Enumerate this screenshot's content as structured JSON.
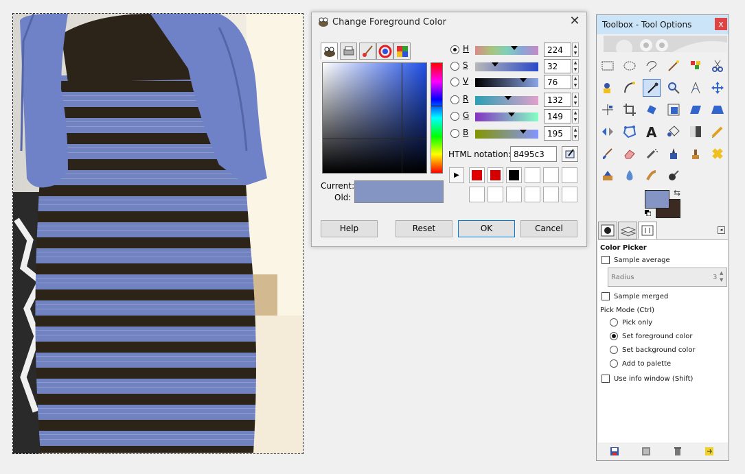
{
  "dialog": {
    "title": "Change Foreground Color",
    "close_glyph": "✕",
    "current_label": "Current:",
    "old_label": "Old:",
    "current_color": "#8495c3",
    "channels": [
      {
        "key": "H",
        "value": "224",
        "selected": true,
        "fraction": 0.62
      },
      {
        "key": "S",
        "value": "32",
        "selected": false,
        "fraction": 0.32
      },
      {
        "key": "V",
        "value": "76",
        "selected": false,
        "fraction": 0.76
      },
      {
        "key": "R",
        "value": "132",
        "selected": false,
        "fraction": 0.52
      },
      {
        "key": "G",
        "value": "149",
        "selected": false,
        "fraction": 0.58
      },
      {
        "key": "B",
        "value": "195",
        "selected": false,
        "fraction": 0.76
      }
    ],
    "html_notation_label": "HTML notation:",
    "html_notation_value": "8495c3",
    "history_colors": [
      "#e00000",
      "#d40000",
      "#000000",
      "#ffffff",
      "#ffffff",
      "#ffffff",
      "#ffffff",
      "#ffffff",
      "#ffffff",
      "#ffffff",
      "#ffffff",
      "#ffffff"
    ],
    "buttons": {
      "help": "Help",
      "reset": "Reset",
      "ok": "OK",
      "cancel": "Cancel"
    },
    "notebook_tabs": [
      "wilber-icon",
      "printer-icon",
      "paintbrush-icon",
      "color-wheel-icon",
      "palette-icon"
    ]
  },
  "toolbox": {
    "title": "Toolbox - Tool Options",
    "close_glyph": "x",
    "foreground_color": "#8495c3",
    "background_color": "#3b2a22",
    "tools": [
      "rect-select-icon",
      "ellipse-select-icon",
      "lasso-icon",
      "fuzzy-select-icon",
      "color-select-icon",
      "scissors-icon",
      "foreground-select-icon",
      "paths-icon",
      "color-picker-icon",
      "zoom-icon",
      "measure-icon",
      "move-icon",
      "align-icon",
      "crop-icon",
      "rotate-icon",
      "scale-icon",
      "shear-icon",
      "perspective-icon",
      "flip-icon",
      "cage-icon",
      "text-icon",
      "bucket-fill-icon",
      "gradient-icon",
      "pencil-icon",
      "paintbrush-icon",
      "eraser-icon",
      "airbrush-icon",
      "ink-icon",
      "clone-icon",
      "heal-icon",
      "perspective-clone-icon",
      "blur-icon",
      "smudge-icon",
      "dodge-icon"
    ],
    "options": {
      "title": "Color Picker",
      "sample_average": "Sample average",
      "radius_label": "Radius",
      "radius_value": "3",
      "sample_merged": "Sample merged",
      "pick_mode_label": "Pick Mode  (Ctrl)",
      "modes": [
        {
          "label": "Pick only",
          "selected": false
        },
        {
          "label": "Set foreground color",
          "selected": true
        },
        {
          "label": "Set background color",
          "selected": false
        },
        {
          "label": "Add to palette",
          "selected": false
        }
      ],
      "use_info_window": "Use info window  (Shift)"
    }
  },
  "colors": {
    "dress_blue": "#7082c0",
    "lace_black": "#2c2418",
    "accent": "#3d74c4"
  }
}
